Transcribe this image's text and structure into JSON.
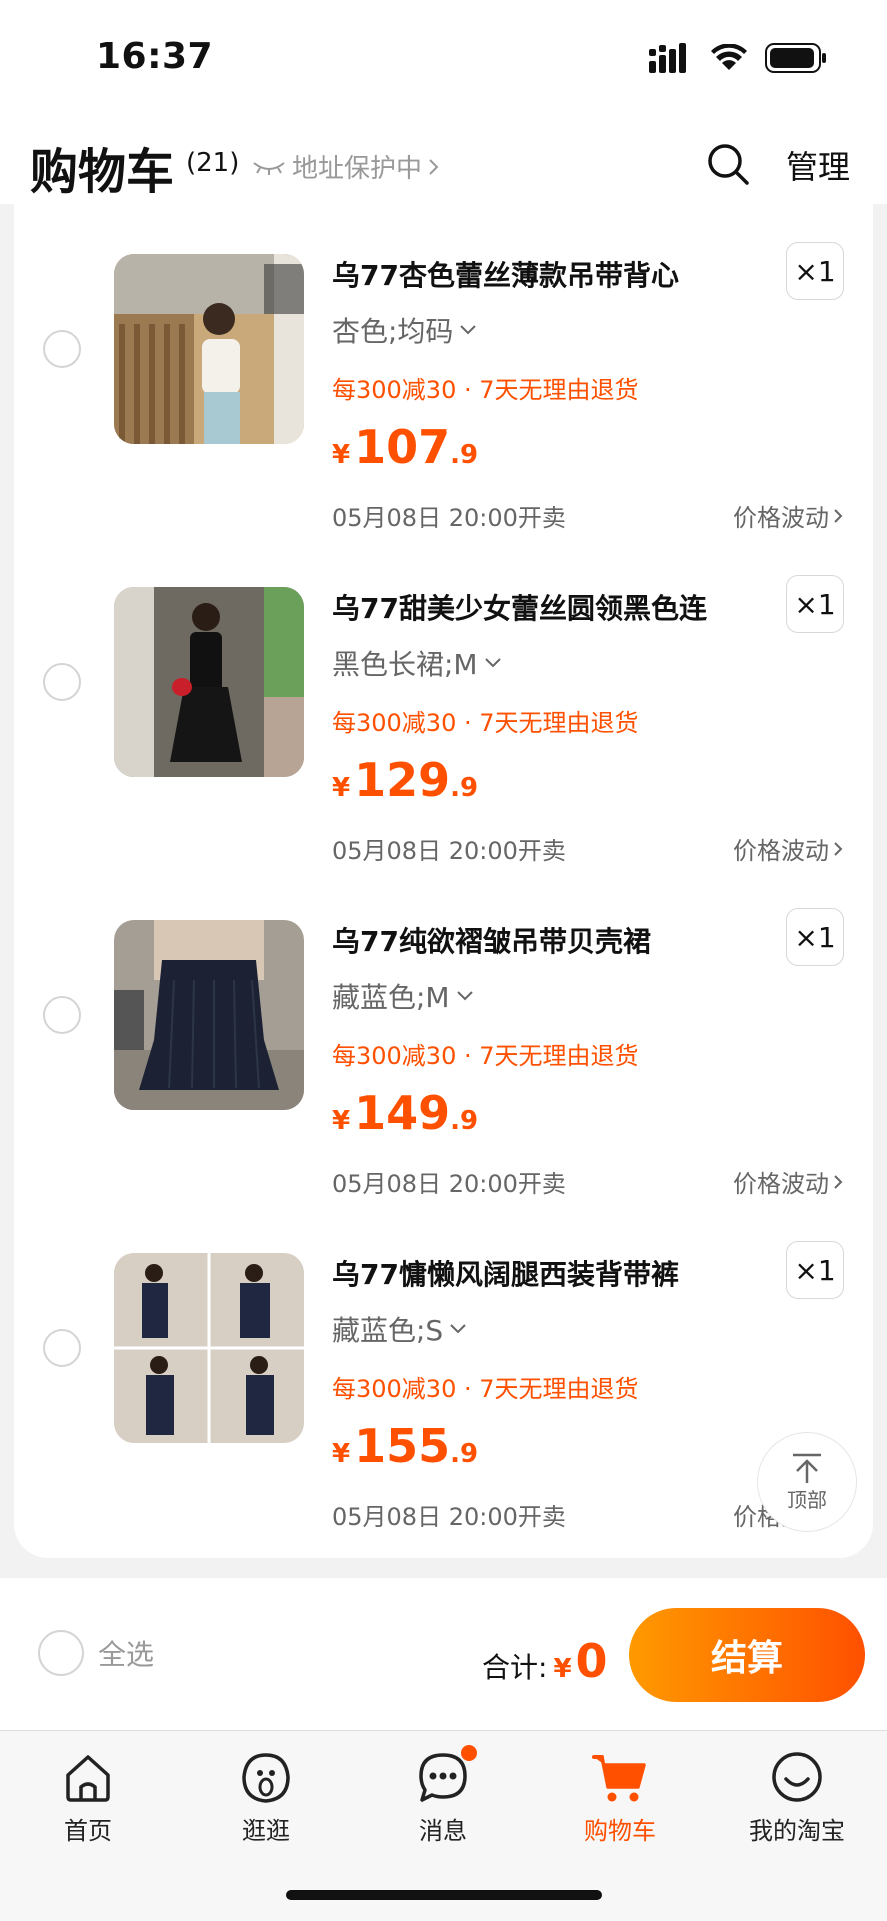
{
  "status_bar": {
    "time": "16:37"
  },
  "header": {
    "title": "购物车",
    "count": "(21)",
    "address_label": "地址保护中",
    "manage_label": "管理"
  },
  "items": [
    {
      "title": "乌77杏色蕾丝薄款吊带背心",
      "sku": "杏色;均码",
      "promo": "每300减30 · 7天无理由退货",
      "currency": "¥",
      "price_int": "107",
      "price_dec": ".9",
      "sale_time": "05月08日 20:00开卖",
      "trend_label": "价格波动",
      "qty": "×1"
    },
    {
      "title": "乌77甜美少女蕾丝圆领黑色连",
      "sku": "黑色长裙;M",
      "promo": "每300减30 · 7天无理由退货",
      "currency": "¥",
      "price_int": "129",
      "price_dec": ".9",
      "sale_time": "05月08日 20:00开卖",
      "trend_label": "价格波动",
      "qty": "×1"
    },
    {
      "title": "乌77纯欲褶皱吊带贝壳裙",
      "sku": "藏蓝色;M",
      "promo": "每300减30 · 7天无理由退货",
      "currency": "¥",
      "price_int": "149",
      "price_dec": ".9",
      "sale_time": "05月08日 20:00开卖",
      "trend_label": "价格波动",
      "qty": "×1"
    },
    {
      "title": "乌77慵懒风阔腿西装背带裤",
      "sku": "藏蓝色;S",
      "promo": "每300减30 · 7天无理由退货",
      "currency": "¥",
      "price_int": "155",
      "price_dec": ".9",
      "sale_time": "05月08日 20:00开卖",
      "trend_label": "价格波动",
      "qty": "×1"
    }
  ],
  "back_to_top_label": "顶部",
  "checkout": {
    "select_all_label": "全选",
    "total_label": "合计:",
    "currency": "¥",
    "total_amount": "0",
    "button_label": "结算"
  },
  "tabs": [
    {
      "label": "首页",
      "icon": "home-icon"
    },
    {
      "label": "逛逛",
      "icon": "explore-icon"
    },
    {
      "label": "消息",
      "icon": "message-icon"
    },
    {
      "label": "购物车",
      "icon": "cart-icon"
    },
    {
      "label": "我的淘宝",
      "icon": "profile-icon"
    }
  ],
  "colors": {
    "accent": "#ff5000",
    "accent_gradient_start": "#ff9a00"
  }
}
